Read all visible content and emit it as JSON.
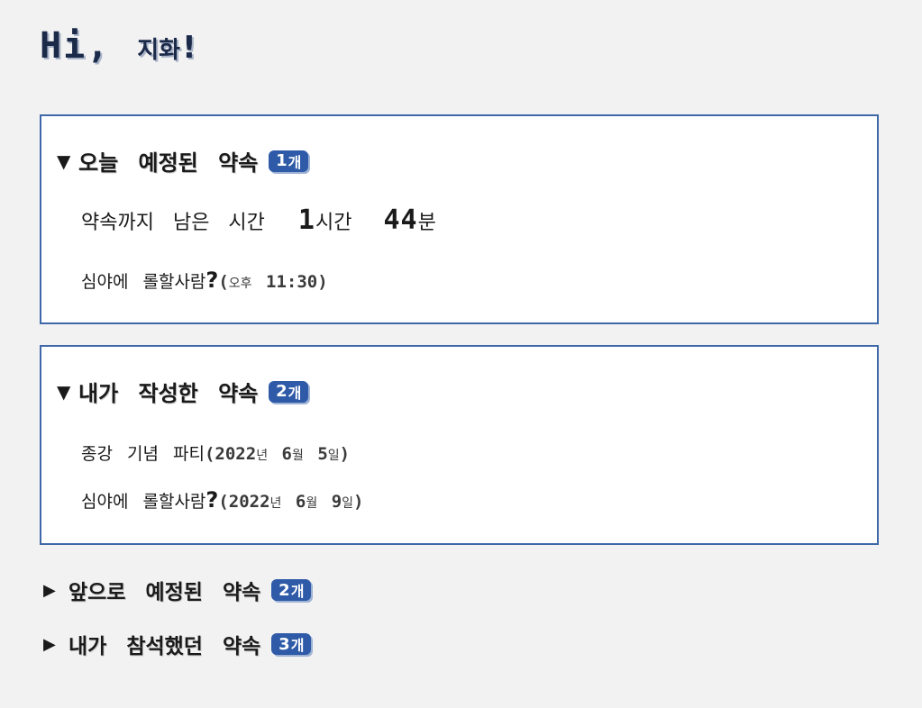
{
  "greeting": {
    "hi": "Hi,",
    "name": "지화",
    "bang": "!"
  },
  "sections": {
    "today": {
      "arrow": "▼",
      "title": "오늘 예정된 약속",
      "count": "1",
      "unit": "개",
      "remaining": {
        "prefix": "약속까지 남은 시간",
        "hours": "1",
        "hours_unit": "시간",
        "minutes": "44",
        "minutes_unit": "분"
      },
      "items": [
        {
          "name": "심야에 롤할사람",
          "q": "?",
          "open": "(",
          "ampm": "오후",
          "time": "11:30",
          "close": ")"
        }
      ]
    },
    "mine": {
      "arrow": "▼",
      "title": "내가 작성한 약속",
      "count": "2",
      "unit": "개",
      "items": [
        {
          "name": "종강 기념 파티",
          "q": "",
          "year": "2022",
          "year_unit": "년",
          "month": "6",
          "month_unit": "월",
          "day": "5",
          "day_unit": "일"
        },
        {
          "name": "심야에 롤할사람",
          "q": "?",
          "year": "2022",
          "year_unit": "년",
          "month": "6",
          "month_unit": "월",
          "day": "9",
          "day_unit": "일"
        }
      ]
    },
    "upcoming": {
      "arrow": "▶",
      "title": "앞으로 예정된 약속",
      "count": "2",
      "unit": "개"
    },
    "attended": {
      "arrow": "▶",
      "title": "내가 참석했던 약속",
      "count": "3",
      "unit": "개"
    }
  },
  "colors": {
    "accent": "#2e5aa8",
    "border": "#3e68a8",
    "background": "#f2f2f2"
  }
}
